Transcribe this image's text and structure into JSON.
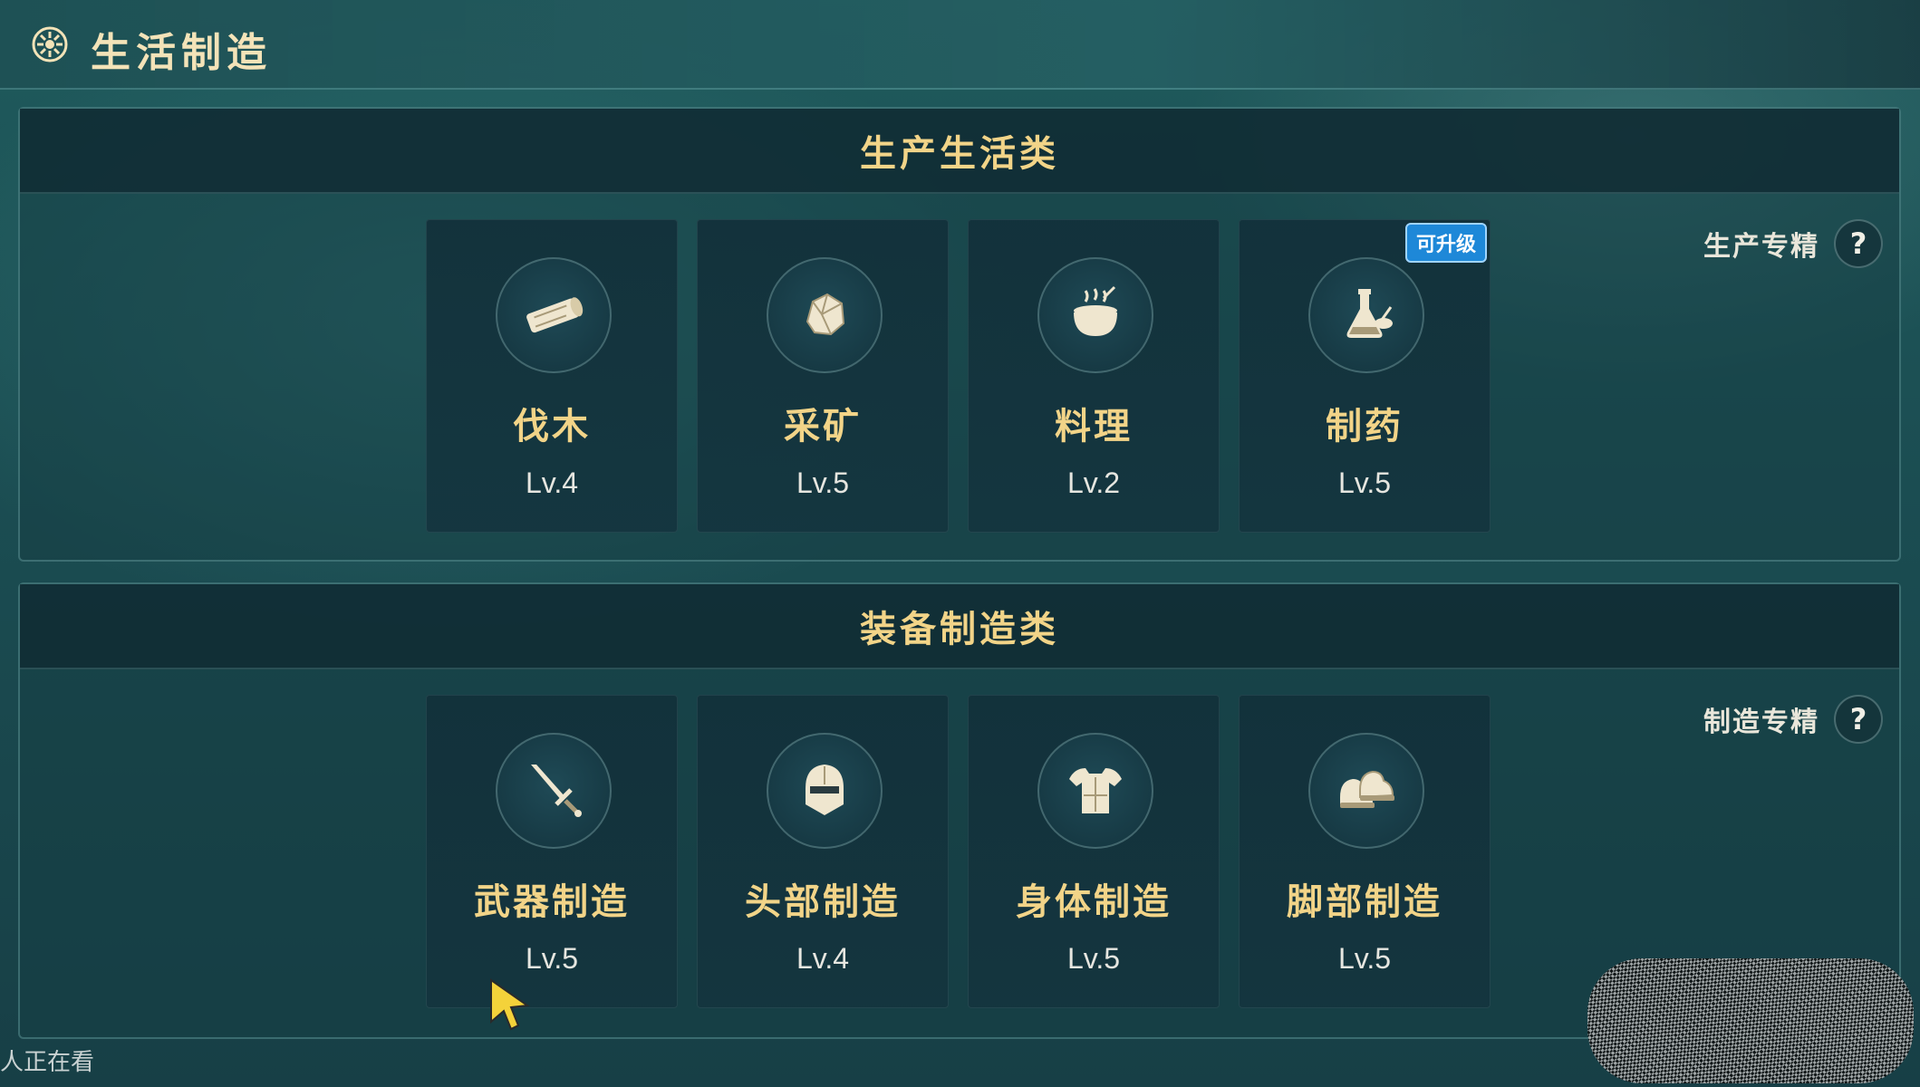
{
  "header": {
    "title": "生活制造",
    "icon": "gear-emblem-icon"
  },
  "sections": [
    {
      "title": "生产生活类",
      "spec_label": "生产专精",
      "help": "?",
      "cards": [
        {
          "name": "伐木",
          "level": "Lv.4",
          "icon": "log-icon"
        },
        {
          "name": "采矿",
          "level": "Lv.5",
          "icon": "ore-icon"
        },
        {
          "name": "料理",
          "level": "Lv.2",
          "icon": "cooking-pot-icon"
        },
        {
          "name": "制药",
          "level": "Lv.5",
          "icon": "potion-flask-icon",
          "badge": "可升级"
        }
      ]
    },
    {
      "title": "装备制造类",
      "spec_label": "制造专精",
      "help": "?",
      "cards": [
        {
          "name": "武器制造",
          "level": "Lv.5",
          "icon": "sword-icon"
        },
        {
          "name": "头部制造",
          "level": "Lv.4",
          "icon": "helmet-icon"
        },
        {
          "name": "身体制造",
          "level": "Lv.5",
          "icon": "armor-icon"
        },
        {
          "name": "脚部制造",
          "level": "Lv.5",
          "icon": "boots-icon"
        }
      ]
    }
  ],
  "footer": {
    "viewing_text": "人正在看"
  },
  "colors": {
    "accent_gold": "#f2d488",
    "badge_blue": "#1e88d8"
  }
}
